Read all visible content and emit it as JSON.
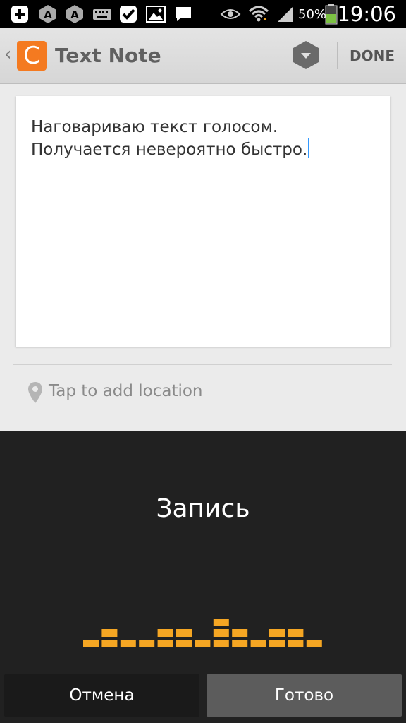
{
  "status_bar": {
    "battery_percent": "50%",
    "time": "19:06",
    "battery_level": 0.5,
    "icons": [
      "add-icon",
      "app-icon",
      "app-icon",
      "keyboard-icon",
      "check-icon",
      "image-icon",
      "message-icon",
      "eye-icon",
      "wifi-icon",
      "signal-icon",
      "battery-icon"
    ]
  },
  "action_bar": {
    "back_glyph": "‹",
    "app_logo_letter": "C",
    "title": "Text Note",
    "done_label": "DONE"
  },
  "note": {
    "text": "Наговариваю текст голосом.\nПолучается невероятно быстро."
  },
  "location": {
    "label": "Tap to add location"
  },
  "voice_dialog": {
    "title": "Запись",
    "cancel_label": "Отмена",
    "ok_label": "Готово",
    "level_bars": [
      1,
      2,
      1,
      1,
      2,
      2,
      1,
      3,
      2,
      1,
      2,
      2,
      1
    ],
    "accent_color": "#f5a623"
  },
  "colors": {
    "app_orange": "#f47a20",
    "cursor_blue": "#3399ff",
    "panel_dark": "#212121"
  }
}
